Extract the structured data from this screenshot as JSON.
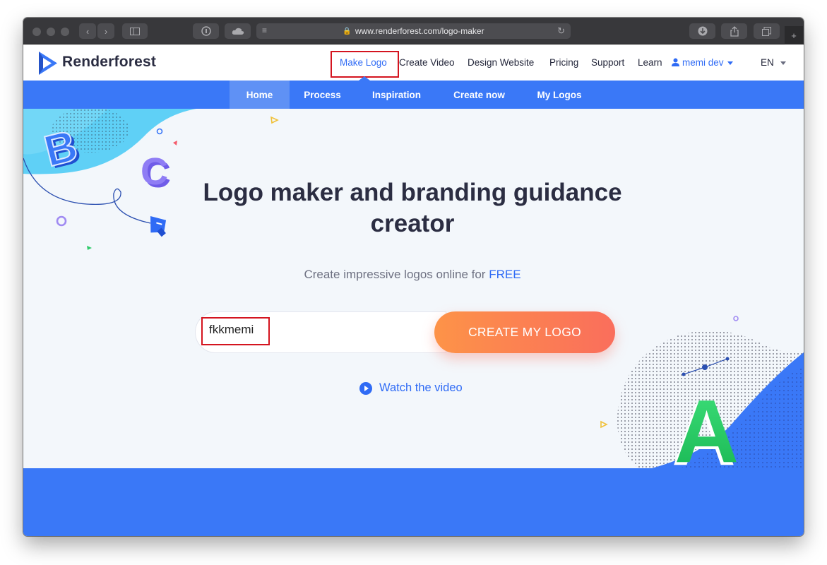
{
  "browser": {
    "url": "www.renderforest.com/logo-maker"
  },
  "header": {
    "brand": "Renderforest",
    "nav": [
      {
        "label": "Make Logo",
        "active": true
      },
      {
        "label": "Create Video"
      },
      {
        "label": "Design Website"
      },
      {
        "label": "Pricing"
      },
      {
        "label": "Support"
      },
      {
        "label": "Learn"
      }
    ],
    "user": "memi dev",
    "language": "EN"
  },
  "subnav": {
    "items": [
      "Home",
      "Process",
      "Inspiration",
      "Create now",
      "My Logos"
    ],
    "active": "Home"
  },
  "hero": {
    "title_line1": "Logo maker and branding guidance",
    "title_line2": "creator",
    "subtitle": "Create impressive logos online for",
    "subtitle_highlight": "FREE",
    "input_value": "fkkmemi",
    "cta": "CREATE MY LOGO",
    "watch_video": "Watch the video"
  },
  "decor_letters": {
    "b": "B",
    "c": "C",
    "a": "A"
  },
  "colors": {
    "brand_blue": "#3a78f7",
    "link_blue": "#2f6bf5",
    "cta_orange": "#fd9348",
    "highlight_red": "#d4141f",
    "title_dark": "#2b2d42"
  }
}
